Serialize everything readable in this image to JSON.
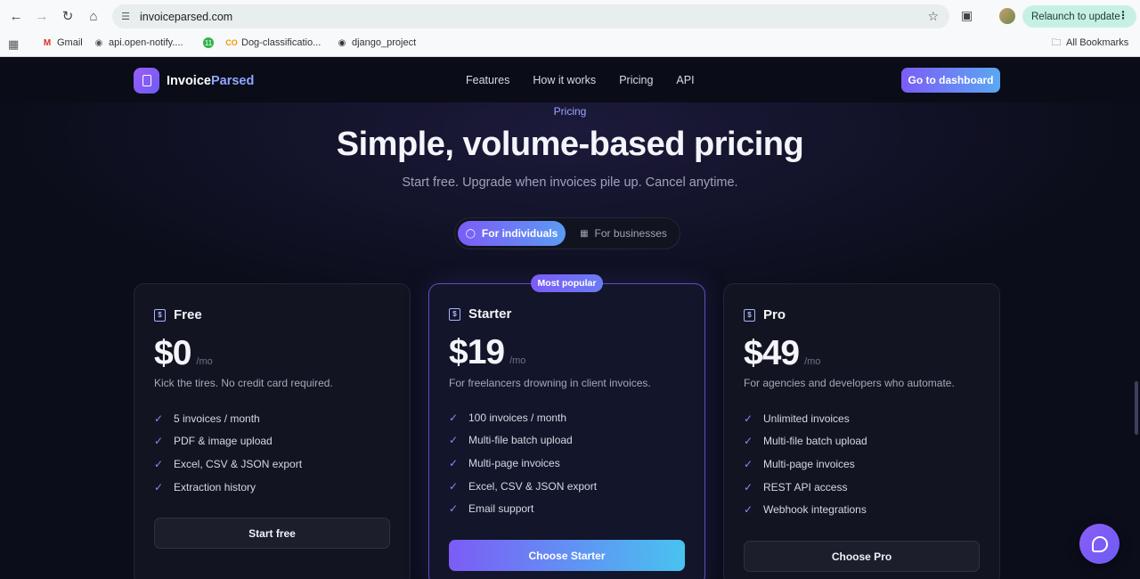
{
  "browser": {
    "url": "invoiceparsed.com",
    "relaunch_label": "Relaunch to update",
    "bookmarks": [
      {
        "label": "Gmail",
        "icon": "gmail-icon"
      },
      {
        "label": "api.open-notify....",
        "icon": "globe-icon"
      },
      {
        "label": "",
        "icon": "green-app-icon"
      },
      {
        "label": "Dog-classificatio...",
        "icon": "colab-icon"
      },
      {
        "label": "django_project",
        "icon": "globe-icon"
      }
    ],
    "all_bookmarks_label": "All Bookmarks"
  },
  "nav": {
    "logo_main": "Invoice",
    "logo_accent": "Parsed",
    "links": [
      "Features",
      "How it works",
      "Pricing",
      "API"
    ],
    "cta": "Go to dashboard"
  },
  "hero": {
    "eyebrow": "Pricing",
    "title": "Simple, volume-based pricing",
    "subtitle": "Start free. Upgrade when invoices pile up. Cancel anytime."
  },
  "toggle": {
    "options": [
      "For individuals",
      "For businesses"
    ],
    "selected": "For individuals"
  },
  "plans": [
    {
      "name": "Free",
      "price": "$0",
      "period": "/mo",
      "description": "Kick the tires. No credit card required.",
      "features": [
        "5 invoices / month",
        "PDF & image upload",
        "Excel, CSV & JSON export",
        "Extraction history"
      ],
      "cta": "Start free"
    },
    {
      "name": "Starter",
      "badge": "Most popular",
      "price": "$19",
      "period": "/mo",
      "description": "For freelancers drowning in client invoices.",
      "features": [
        "100 invoices / month",
        "Multi-file batch upload",
        "Multi-page invoices",
        "Excel, CSV & JSON export",
        "Email support"
      ],
      "cta": "Choose Starter"
    },
    {
      "name": "Pro",
      "price": "$49",
      "period": "/mo",
      "description": "For agencies and developers who automate.",
      "features": [
        "Unlimited invoices",
        "Multi-file batch upload",
        "Multi-page invoices",
        "REST API access",
        "Webhook integrations"
      ],
      "cta": "Choose Pro"
    }
  ],
  "colors": {
    "accent": "#7c5cf6",
    "accent_end": "#48c3f0",
    "background": "#0b0d1a"
  }
}
